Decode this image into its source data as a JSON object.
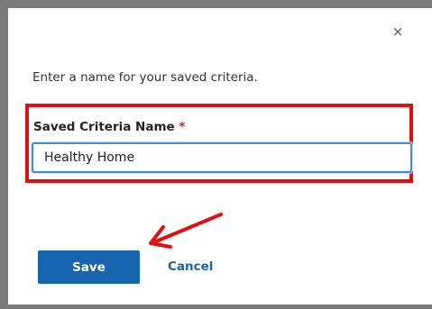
{
  "dialog": {
    "close_glyph": "×",
    "prompt": "Enter a name for your saved criteria.",
    "field_label": "Saved Criteria Name",
    "required_marker": "*",
    "input_value": "Healthy Home",
    "save_label": "Save",
    "cancel_label": "Cancel"
  },
  "annotation": {
    "highlight_color": "#e01010",
    "arrow_color": "#e01010"
  },
  "colors": {
    "primary": "#1764ae",
    "focus_border": "#3f8ede",
    "required": "#d11a1a"
  },
  "icons": {
    "close": "close-icon",
    "arrow": "annotation-arrow-icon"
  }
}
